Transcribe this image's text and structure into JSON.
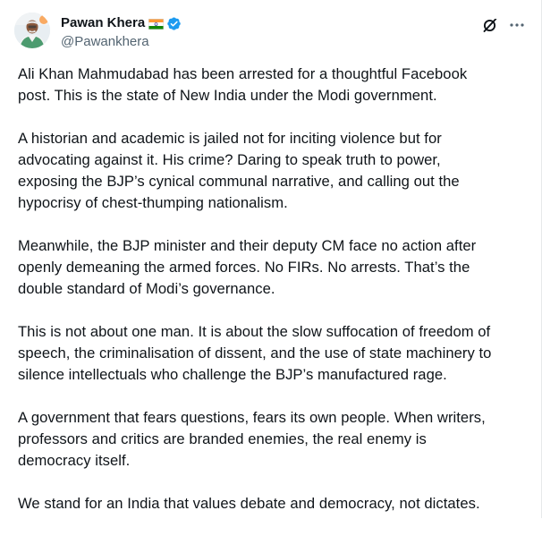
{
  "author": {
    "name": "Pawan Khera",
    "flag_emoji_name": "india-flag-icon",
    "verified_icon": "verified-badge-icon",
    "handle": "@Pawankhera",
    "verified_color": "#1d9bf0"
  },
  "actions": {
    "grok_icon": "grok-icon",
    "more_icon": "more-horizontal-icon"
  },
  "post": {
    "paragraphs": [
      "Ali Khan Mahmudabad has been arrested for a thoughtful Facebook\npost. This is the state of New India under the Modi government.",
      "A historian and academic is jailed not for inciting violence but for\nadvocating against it. His crime? Daring to speak truth to power,\nexposing the BJP’s cynical communal narrative, and calling out the\nhypocrisy of chest-thumping nationalism.",
      "Meanwhile, the BJP minister and their deputy CM face no action after\nopenly demeaning the armed forces. No FIRs. No arrests. That’s the\ndouble standard of Modi’s governance.",
      "This is not about one man. It is about the slow suffocation of freedom of\nspeech, the criminalisation of dissent, and the use of state machinery to\nsilence intellectuals who challenge the BJP’s manufactured rage.",
      "A government that fears questions, fears its own people. When writers,\nprofessors and critics are branded enemies, the real enemy is\ndemocracy itself.",
      "We stand for an India that values debate and democracy, not dictates."
    ]
  }
}
